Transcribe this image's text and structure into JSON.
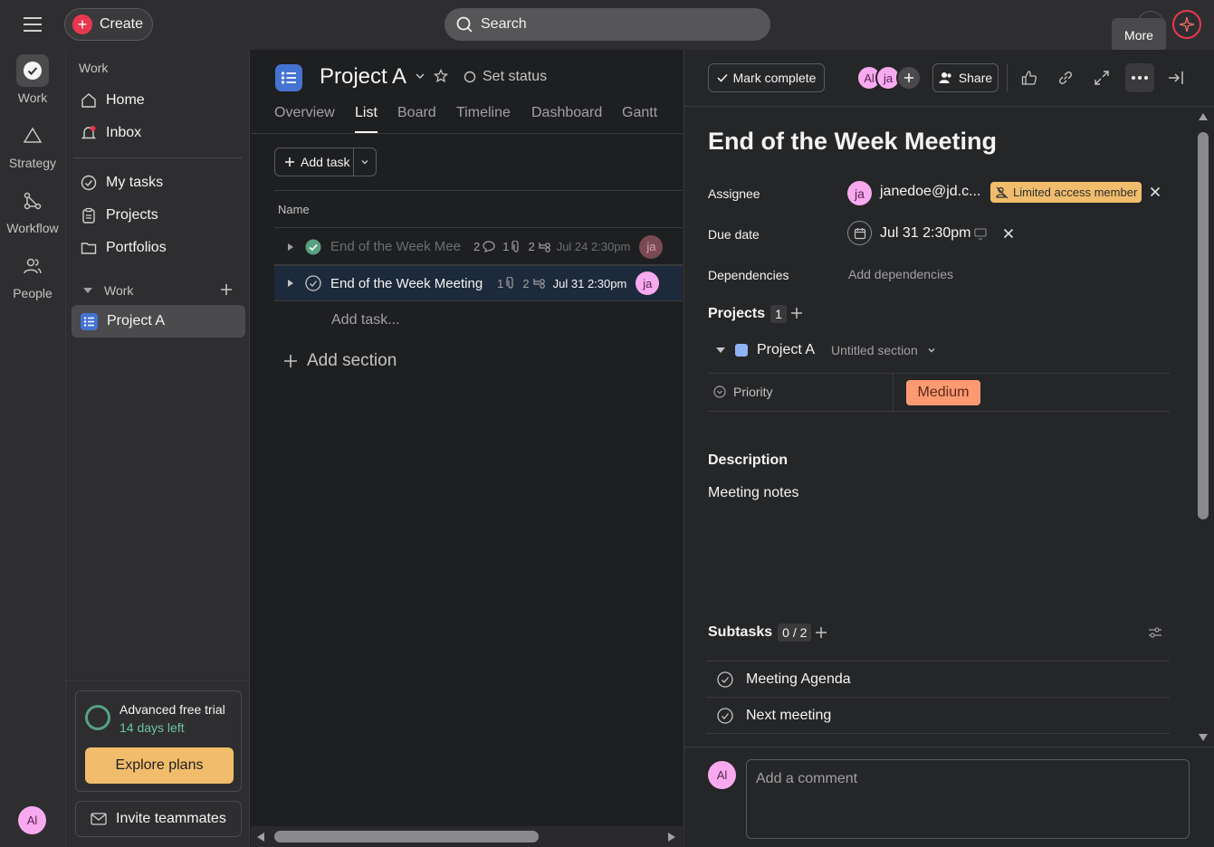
{
  "topbar": {
    "create_label": "Create",
    "search_placeholder": "Search",
    "tooltip": "More"
  },
  "rail": {
    "items": [
      {
        "label": "Work",
        "icon": "check-circle-icon"
      },
      {
        "label": "Strategy",
        "icon": "triangle-icon"
      },
      {
        "label": "Workflow",
        "icon": "workflow-icon"
      },
      {
        "label": "People",
        "icon": "people-icon"
      }
    ],
    "avatar": "Al"
  },
  "sidebar": {
    "section_work": "Work",
    "home": "Home",
    "inbox": "Inbox",
    "my_tasks": "My tasks",
    "projects": "Projects",
    "portfolios": "Portfolios",
    "team_section": "Work",
    "project_a": "Project A",
    "trial_title": "Advanced free trial",
    "trial_days": "14 days left",
    "explore": "Explore plans",
    "invite": "Invite teammates"
  },
  "project": {
    "title": "Project A",
    "set_status": "Set status",
    "tabs": [
      "Overview",
      "List",
      "Board",
      "Timeline",
      "Dashboard",
      "Gantt"
    ],
    "active_tab": "List",
    "add_task": "Add task",
    "col_name": "Name",
    "tasks": [
      {
        "name": "End of the Week Mee",
        "comments": "2",
        "attachments": "1",
        "subtasks": "2",
        "due": "Jul 24 2:30pm",
        "assignee": "ja",
        "completed": true
      },
      {
        "name": "End of the Week Meeting",
        "attachments": "1",
        "subtasks": "2",
        "due": "Jul 31 2:30pm",
        "assignee": "ja",
        "completed": false
      }
    ],
    "add_task_inline": "Add task...",
    "add_section": "Add section"
  },
  "detail": {
    "mark_complete": "Mark complete",
    "collaborators": [
      "Al",
      "ja"
    ],
    "share": "Share",
    "title": "End of the Week Meeting",
    "assignee_label": "Assignee",
    "assignee_initials": "ja",
    "assignee_email": "janedoe@jd.c...",
    "limited_badge": "Limited access member",
    "due_label": "Due date",
    "due_value": "Jul 31 2:30pm",
    "dependencies_label": "Dependencies",
    "dependencies_action": "Add dependencies",
    "projects_label": "Projects",
    "projects_count": "1",
    "project_name": "Project A",
    "project_section": "Untitled section",
    "priority_label": "Priority",
    "priority_value": "Medium",
    "description_label": "Description",
    "description_text": "Meeting notes",
    "subtasks_label": "Subtasks",
    "subtasks_count": "0 / 2",
    "subtasks": [
      "Meeting Agenda",
      "Next meeting"
    ],
    "comment_avatar": "Al",
    "comment_placeholder": "Add a comment"
  },
  "colors": {
    "accent_red": "#e8384f",
    "project_blue": "#4573d2",
    "trial_orange": "#f1bd6c",
    "medium_orange": "#fd9a72",
    "avatar_pink": "#f9aaef",
    "complete_green": "#58a182"
  }
}
